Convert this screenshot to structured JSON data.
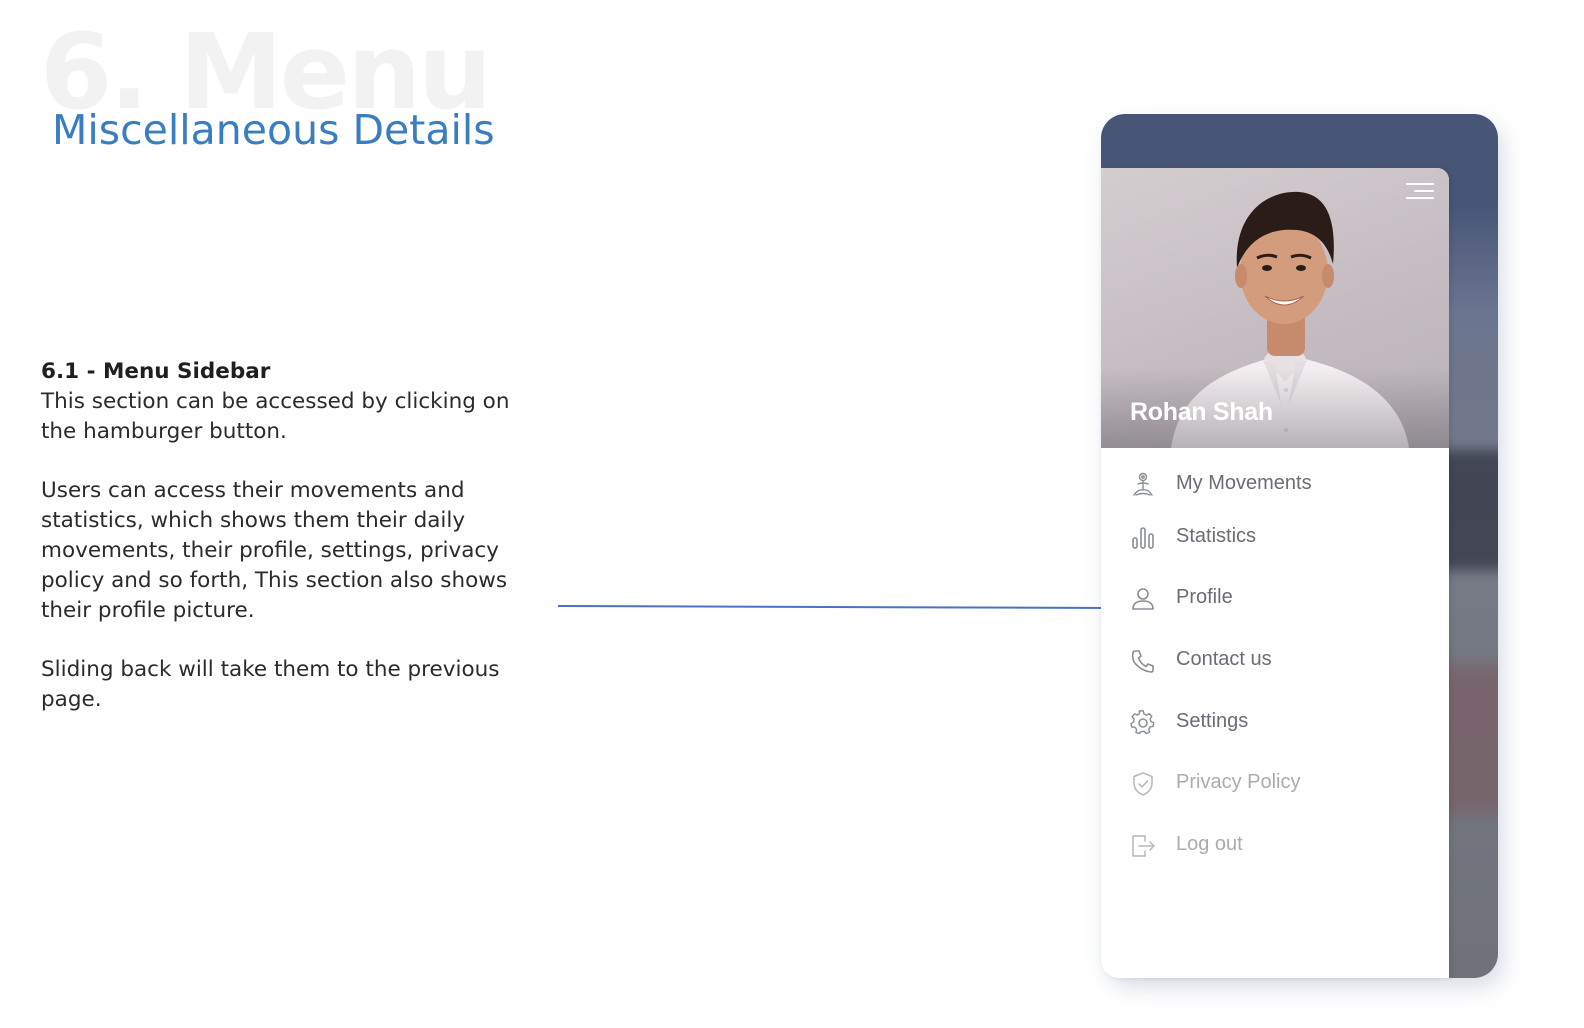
{
  "page": {
    "section_number_title": "6. Menu",
    "subtitle": "Miscellaneous Details"
  },
  "description": {
    "heading": "6.1 - Menu Sidebar",
    "paragraph_1": "This section can be accessed by clicking on the hamburger button.",
    "paragraph_2": "Users can access their movements and statistics, which shows them their daily movements, their profile, settings, privacy policy and so forth, This section also shows their profile picture.",
    "paragraph_3": "Sliding back will take them to the previous page."
  },
  "sidebar": {
    "user_name": "Rohan Shah",
    "menu_button_icon": "hamburger-icon",
    "items": [
      {
        "label": "My Movements",
        "icon": "yoga-figure-icon",
        "state": "normal"
      },
      {
        "label": "Statistics",
        "icon": "bar-chart-icon",
        "state": "normal"
      },
      {
        "label": "Profile",
        "icon": "person-icon",
        "state": "normal"
      },
      {
        "label": "Contact us",
        "icon": "phone-icon",
        "state": "normal"
      },
      {
        "label": "Settings",
        "icon": "gear-icon",
        "state": "normal"
      },
      {
        "label": "Privacy Policy",
        "icon": "shield-check-icon",
        "state": "muted"
      },
      {
        "label": "Log out",
        "icon": "logout-icon",
        "state": "muted"
      }
    ]
  },
  "colors": {
    "accent": "#3a7ebf",
    "connector": "#4a72c4",
    "menu_text": "#6a6d76",
    "menu_text_muted": "#a9acb3",
    "phone_header": "#475677"
  }
}
